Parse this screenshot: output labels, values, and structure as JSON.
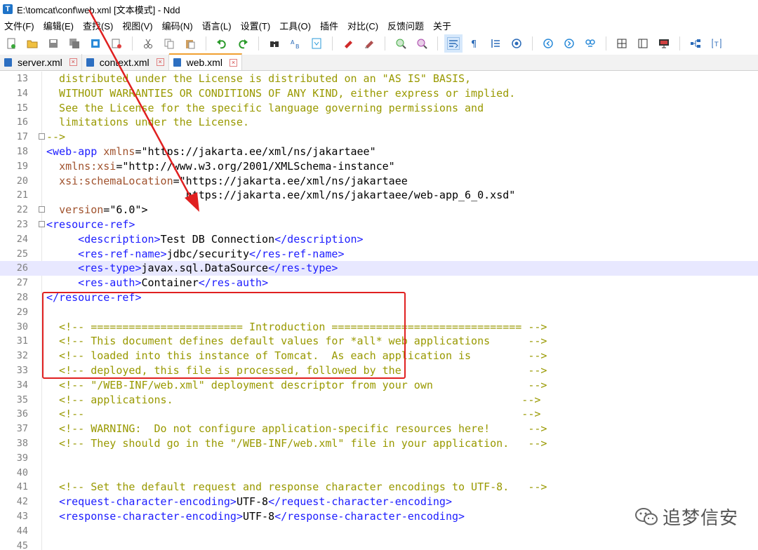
{
  "window": {
    "title": "E:\\tomcat\\conf\\web.xml [文本模式] - Ndd"
  },
  "menu": [
    "文件(F)",
    "编辑(E)",
    "查找(S)",
    "视图(V)",
    "编码(N)",
    "语言(L)",
    "设置(T)",
    "工具(O)",
    "插件",
    "对比(C)",
    "反馈问题",
    "关于"
  ],
  "toolbar": {
    "icons": [
      "new-file-icon",
      "open-folder-icon",
      "save-icon",
      "save-all-icon",
      "close-icon",
      "close-all-icon",
      "cut-icon",
      "copy-icon",
      "paste-icon",
      "undo-icon",
      "redo-icon",
      "find-icon",
      "replace-icon",
      "go-to-icon",
      "bookmark-icon",
      "clear-bookmark-icon",
      "zoom-in-icon",
      "zoom-out-icon",
      "wrap-icon",
      "show-symbols-icon",
      "indent-guide-icon",
      "show-whitespace-icon",
      "prev-icon",
      "next-icon",
      "record-icon",
      "split-icon",
      "column-icon",
      "monitor-icon",
      "tree-icon",
      "text-mode-icon"
    ]
  },
  "tabs": [
    {
      "label": "server.xml",
      "active": false
    },
    {
      "label": "context.xml",
      "active": false
    },
    {
      "label": "web.xml",
      "active": true
    }
  ],
  "editor": {
    "current_line": 26,
    "highlighted_block": {
      "from_line": 23,
      "to_line": 28
    },
    "lines": [
      {
        "n": "13",
        "text": "  distributed under the License is distributed on an \"AS IS\" BASIS,"
      },
      {
        "n": "14",
        "text": "  WITHOUT WARRANTIES OR CONDITIONS OF ANY KIND, either express or implied."
      },
      {
        "n": "15",
        "text": "  See the License for the specific language governing permissions and"
      },
      {
        "n": "16",
        "text": "  limitations under the License."
      },
      {
        "n": "17",
        "text": "-->"
      },
      {
        "n": "18",
        "text": "<web-app xmlns=\"https://jakarta.ee/xml/ns/jakartaee\""
      },
      {
        "n": "19",
        "text": "  xmlns:xsi=\"http://www.w3.org/2001/XMLSchema-instance\""
      },
      {
        "n": "20",
        "text": "  xsi:schemaLocation=\"https://jakarta.ee/xml/ns/jakartaee"
      },
      {
        "n": "21",
        "text": "                      https://jakarta.ee/xml/ns/jakartaee/web-app_6_0.xsd\""
      },
      {
        "n": "22",
        "text": "  version=\"6.0\">"
      },
      {
        "n": "23",
        "text": "<resource-ref>"
      },
      {
        "n": "24",
        "text": "     <description>Test DB Connection</description>"
      },
      {
        "n": "25",
        "text": "     <res-ref-name>jdbc/security</res-ref-name>"
      },
      {
        "n": "26",
        "text": "     <res-type>javax.sql.DataSource</res-type>"
      },
      {
        "n": "27",
        "text": "     <res-auth>Container</res-auth>"
      },
      {
        "n": "28",
        "text": "</resource-ref>"
      },
      {
        "n": "29",
        "text": ""
      },
      {
        "n": "30",
        "text": "  <!-- ======================== Introduction ============================== -->"
      },
      {
        "n": "31",
        "text": "  <!-- This document defines default values for *all* web applications      -->"
      },
      {
        "n": "32",
        "text": "  <!-- loaded into this instance of Tomcat.  As each application is         -->"
      },
      {
        "n": "33",
        "text": "  <!-- deployed, this file is processed, followed by the                    -->"
      },
      {
        "n": "34",
        "text": "  <!-- \"/WEB-INF/web.xml\" deployment descriptor from your own               -->"
      },
      {
        "n": "35",
        "text": "  <!-- applications.                                                       -->"
      },
      {
        "n": "36",
        "text": "  <!--                                                                     -->"
      },
      {
        "n": "37",
        "text": "  <!-- WARNING:  Do not configure application-specific resources here!      -->"
      },
      {
        "n": "38",
        "text": "  <!-- They should go in the \"/WEB-INF/web.xml\" file in your application.   -->"
      },
      {
        "n": "39",
        "text": ""
      },
      {
        "n": "40",
        "text": ""
      },
      {
        "n": "41",
        "text": "  <!-- Set the default request and response character encodings to UTF-8.   -->"
      },
      {
        "n": "42",
        "text": "  <request-character-encoding>UTF-8</request-character-encoding>"
      },
      {
        "n": "43",
        "text": "  <response-character-encoding>UTF-8</response-character-encoding>"
      },
      {
        "n": "44",
        "text": ""
      },
      {
        "n": "45",
        "text": ""
      }
    ]
  },
  "watermark": {
    "text": "追梦信安"
  },
  "colors": {
    "highlight_box": "#e02020",
    "arrow": "#e02020",
    "comment": "#999900",
    "tag": "#1c1cff",
    "attr": "#a0522d",
    "current_line_bg": "#e8e8ff"
  }
}
